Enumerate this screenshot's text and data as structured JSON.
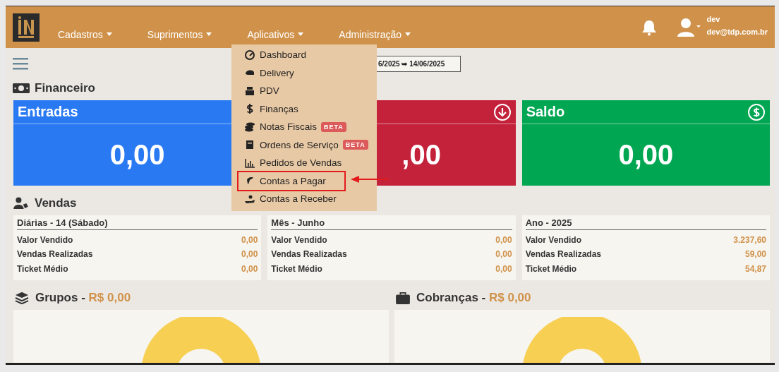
{
  "header": {
    "nav": [
      {
        "label": "Cadastros"
      },
      {
        "label": "Suprimentos"
      },
      {
        "label": "Aplicativos"
      },
      {
        "label": "Administração"
      }
    ],
    "user": {
      "name": "dev",
      "email": "dev@tdp.com.br"
    }
  },
  "date_range": {
    "value": "6/2025 ➥ 14/06/2025"
  },
  "financeiro": {
    "title": "Financeiro",
    "cards": [
      {
        "kind": "in",
        "title": "Entradas",
        "value": "0,00"
      },
      {
        "kind": "out",
        "value": ",00"
      },
      {
        "kind": "balance",
        "title": "Saldo",
        "value": "0,00"
      }
    ]
  },
  "vendas": {
    "title": "Vendas",
    "panels": [
      {
        "title": "Diárias - 14 (Sábado)",
        "rows": [
          {
            "label": "Valor Vendido",
            "value": "0,00"
          },
          {
            "label": "Vendas Realizadas",
            "value": "0,00"
          },
          {
            "label": "Ticket Médio",
            "value": "0,00"
          }
        ]
      },
      {
        "title": "Mês - Junho",
        "rows": [
          {
            "label": "Valor Vendido",
            "value": "0,00"
          },
          {
            "label": "Vendas Realizadas",
            "value": "0,00"
          },
          {
            "label": "Ticket Médio",
            "value": "0,00"
          }
        ]
      },
      {
        "title": "Ano - 2025",
        "rows": [
          {
            "label": "Valor Vendido",
            "value": "3.237,60"
          },
          {
            "label": "Vendas Realizadas",
            "value": "59,00"
          },
          {
            "label": "Ticket Médio",
            "value": "54,87"
          }
        ]
      }
    ]
  },
  "charts": [
    {
      "kind": "groups",
      "title": "Grupos -",
      "amount": "R$ 0,00"
    },
    {
      "kind": "charges",
      "title": "Cobranças -",
      "amount": "R$ 0,00"
    }
  ],
  "menu": {
    "items": [
      {
        "label": "Dashboard",
        "highlighted": false
      },
      {
        "label": "Delivery",
        "highlighted": false
      },
      {
        "label": "PDV",
        "highlighted": false
      },
      {
        "label": "Finanças",
        "highlighted": false
      },
      {
        "label": "Notas Fiscais",
        "badge": "BETA",
        "highlighted": false
      },
      {
        "label": "Ordens de Serviço",
        "badge": "BETA",
        "highlighted": false
      },
      {
        "label": "Pedidos de Vendas",
        "highlighted": false
      },
      {
        "label": "Contas a Pagar",
        "highlighted": true
      },
      {
        "label": "Contas a Receber",
        "highlighted": false
      }
    ]
  }
}
